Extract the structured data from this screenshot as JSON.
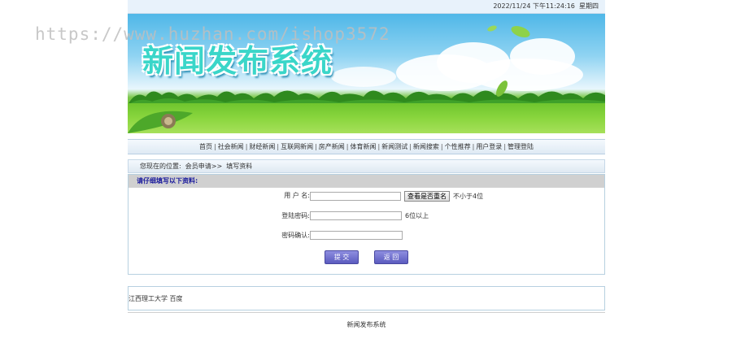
{
  "topbar": {
    "datetime": "2022/11/24 下午11:24:16",
    "weekday": "星期四"
  },
  "banner": {
    "title": "新闻发布系统"
  },
  "watermark": "https://www.huzhan.com/ishop3572",
  "nav": {
    "items": [
      "首页",
      "社会新闻",
      "财经新闻",
      "互联网新闻",
      "房产新闻",
      "体育新闻",
      "新闻测试",
      "新闻搜索",
      "个性推荐",
      "用户登录",
      "管理登陆"
    ],
    "separator": "|"
  },
  "location": {
    "prefix": "您现在的位置:",
    "path": "会员申请>>",
    "current": "填写资料"
  },
  "form": {
    "heading": "请仔细填写以下资料:",
    "username_label": "用 户 名:",
    "username_value": "",
    "check_button": "查看是否重名",
    "username_hint": "不小于4位",
    "password_label": "登陆密码:",
    "password_value": "",
    "password_hint": "6位以上",
    "confirm_label": "密码确认:",
    "confirm_value": "",
    "submit_label": "提 交",
    "back_label": "返 回"
  },
  "links": {
    "items": [
      "江西理工大学",
      "百度"
    ]
  },
  "footer": {
    "text": "新闻发布系统"
  }
}
